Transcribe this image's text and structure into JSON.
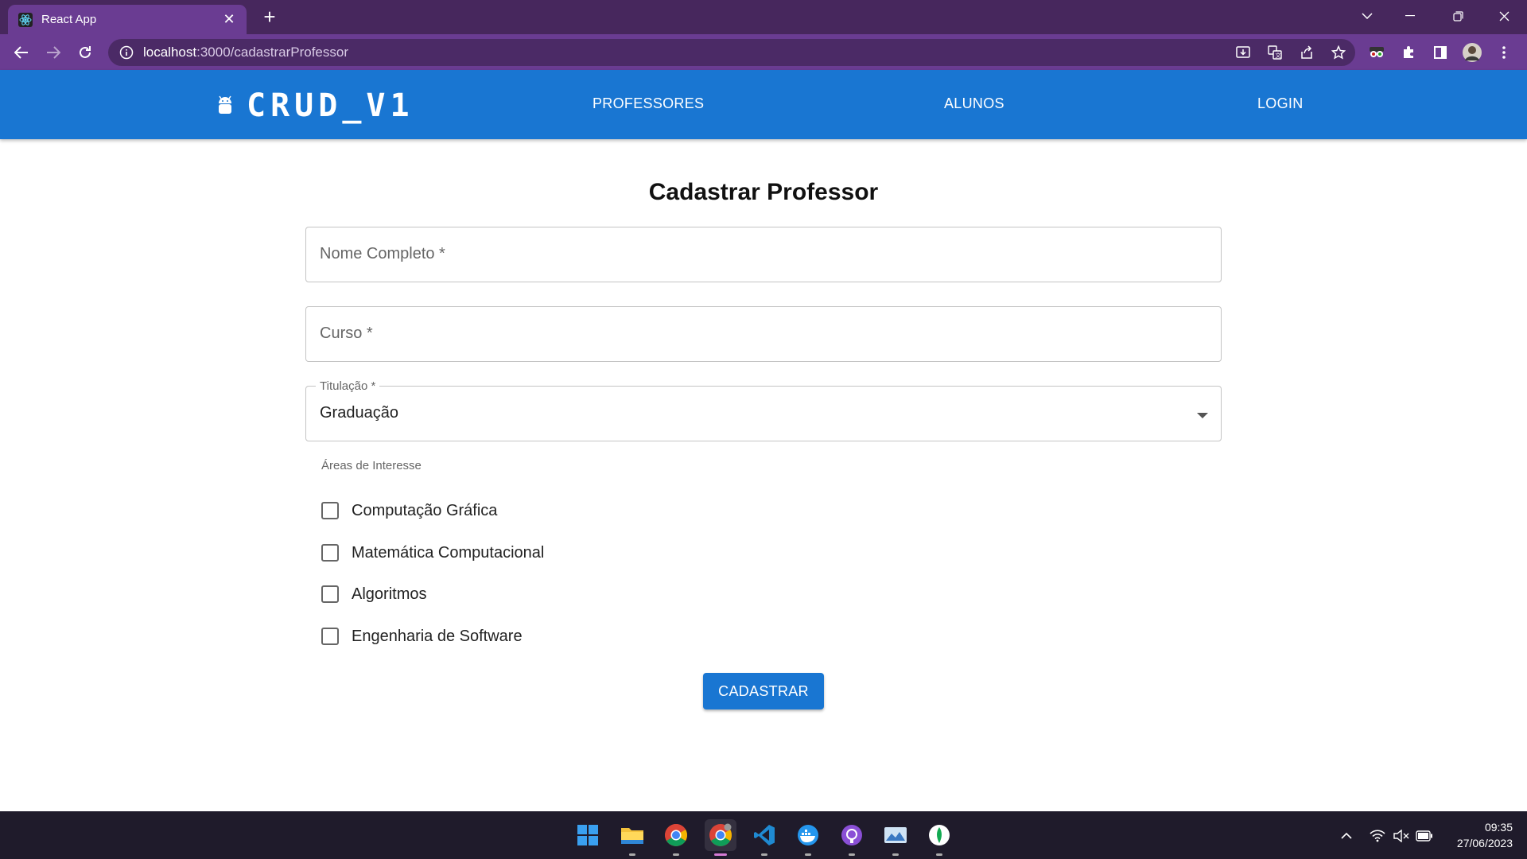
{
  "browser": {
    "tab_title": "React App",
    "url_host": "localhost",
    "url_path": ":3000/cadastrarProfessor"
  },
  "appbar": {
    "brand": "CRUD_V1",
    "nav": [
      "PROFESSORES",
      "ALUNOS",
      "LOGIN"
    ]
  },
  "form": {
    "title": "Cadastrar Professor",
    "nome_placeholder": "Nome Completo *",
    "curso_placeholder": "Curso *",
    "titulacao_label": "Titulação *",
    "titulacao_value": "Graduação",
    "areas_label": "Áreas de Interesse",
    "areas": [
      {
        "label": "Computação Gráfica",
        "checked": false
      },
      {
        "label": "Matemática Computacional",
        "checked": false
      },
      {
        "label": "Algoritmos",
        "checked": false
      },
      {
        "label": "Engenharia de Software",
        "checked": false
      }
    ],
    "submit_label": "CADASTRAR"
  },
  "taskbar": {
    "apps": [
      "windows-start-icon",
      "file-explorer-icon",
      "chrome-icon",
      "chrome-active-icon",
      "vscode-icon",
      "docker-icon",
      "github-desktop-icon",
      "photos-icon",
      "mongodb-compass-icon"
    ],
    "time": "09:35",
    "date": "27/06/2023"
  },
  "colors": {
    "appbar": "#1976d2",
    "browser_frame": "#6a3c92",
    "button": "#1976d2"
  }
}
